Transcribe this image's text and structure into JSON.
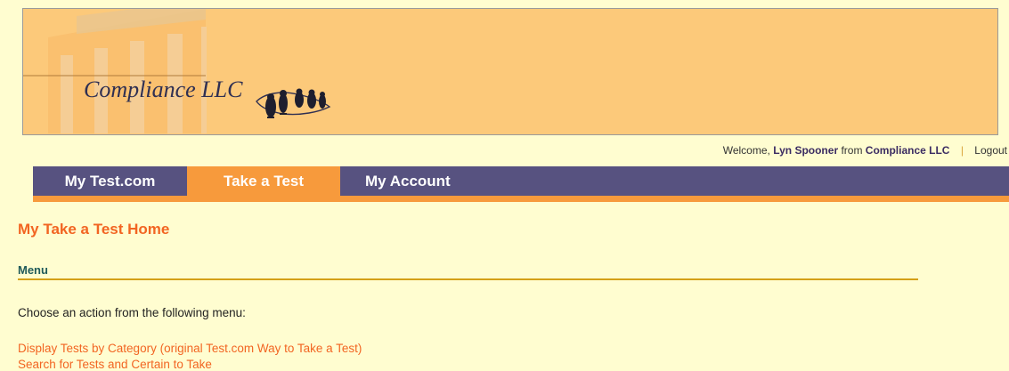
{
  "banner": {
    "logo_text": "Compliance LLC",
    "background_color": "#fcc97a",
    "logo_graphic": "penguins-logo"
  },
  "welcome": {
    "prefix": "Welcome,",
    "user_name": "Lyn Spooner",
    "from_text": "from",
    "company": "Compliance LLC",
    "separator": "|",
    "logout_label": "Logout"
  },
  "nav": {
    "tabs": [
      {
        "label": "My Test.com",
        "active": false
      },
      {
        "label": "Take a Test",
        "active": true
      },
      {
        "label": "My Account",
        "active": false
      }
    ],
    "bar_color": "#575280",
    "active_color": "#f79a3c"
  },
  "main": {
    "page_title": "My Take a Test Home",
    "section_heading": "Menu",
    "intro_text": "Choose an action from the following menu:",
    "menu_items": [
      {
        "label": "Display Tests by Category (original Test.com Way to Take a Test)"
      },
      {
        "label": "Search for Tests and Certain to Take"
      }
    ],
    "accent_color": "#f26522"
  }
}
